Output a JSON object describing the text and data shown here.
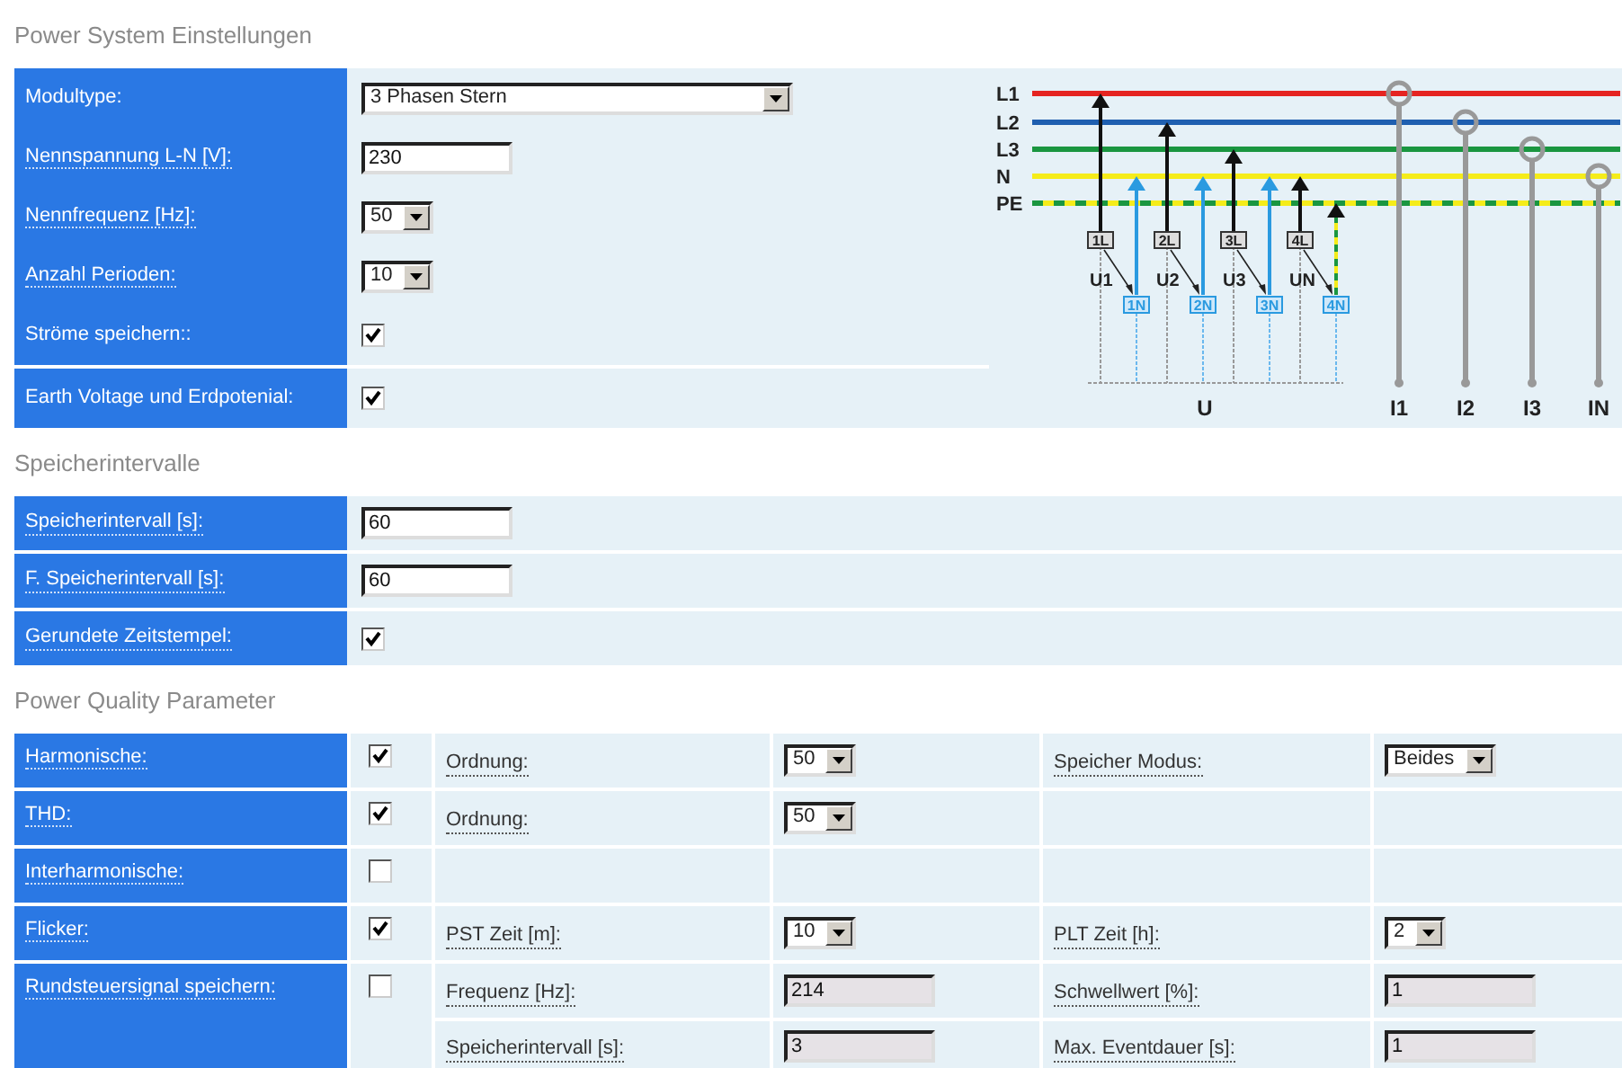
{
  "sections": [
    {
      "title": "Power System Einstellungen",
      "groups": [
        [
          {
            "label": "Modultype:",
            "underlined": false,
            "control": {
              "kind": "select-wide",
              "value": "3 Phasen Stern"
            }
          },
          {
            "label": "Nennspannung L-N [V]:",
            "underlined": true,
            "control": {
              "kind": "input",
              "value": "230",
              "disabled": false
            }
          },
          {
            "label": "Nennfrequenz [Hz]:",
            "underlined": true,
            "control": {
              "kind": "select",
              "value": "50"
            }
          },
          {
            "label": "Anzahl Perioden:",
            "underlined": true,
            "control": {
              "kind": "select",
              "value": "10"
            }
          },
          {
            "label": "Ströme speichern::",
            "underlined": false,
            "control": {
              "kind": "checkbox",
              "checked": true
            }
          }
        ],
        [
          {
            "label": "Earth Voltage und Erdpotenial:",
            "underlined": false,
            "control": {
              "kind": "checkbox",
              "checked": true
            }
          }
        ]
      ],
      "diagram": {
        "lines": [
          {
            "label": "L1",
            "color": "#e52421",
            "kind": "solid"
          },
          {
            "label": "L2",
            "color": "#1f5fb0",
            "kind": "solid"
          },
          {
            "label": "L3",
            "color": "#1a9640",
            "kind": "solid"
          },
          {
            "label": "N",
            "color": "#f5ec1a",
            "kind": "solid"
          },
          {
            "label": "PE",
            "color": "#1a9640",
            "kind": "striped"
          }
        ],
        "channels": [
          {
            "l_terminal": "1L",
            "voltage": "U1",
            "n_terminal": "1N"
          },
          {
            "l_terminal": "2L",
            "voltage": "U2",
            "n_terminal": "2N"
          },
          {
            "l_terminal": "3L",
            "voltage": "U3",
            "n_terminal": "3N"
          },
          {
            "l_terminal": "4L",
            "voltage": "UN",
            "n_terminal": "4N"
          }
        ],
        "voltage_label": "U",
        "currents": [
          "I1",
          "I2",
          "I3",
          "IN"
        ]
      }
    },
    {
      "title": "Speicherintervalle",
      "groups": [
        [
          {
            "label": "Speicherintervall [s]:",
            "underlined": true,
            "control": {
              "kind": "input",
              "value": "60",
              "disabled": false
            }
          }
        ],
        [
          {
            "label": "F. Speicherintervall [s]:",
            "underlined": true,
            "control": {
              "kind": "input",
              "value": "60",
              "disabled": false
            }
          }
        ],
        [
          {
            "label": "Gerundete Zeitstempel:",
            "underlined": true,
            "control": {
              "kind": "checkbox",
              "checked": true
            }
          }
        ]
      ]
    },
    {
      "title": "Power Quality Parameter",
      "rows": [
        {
          "label": "Harmonische:",
          "checked": true,
          "lines": [
            [
              {
                "label": "Ordnung:",
                "control": {
                  "kind": "select",
                  "value": "50"
                }
              },
              {
                "label": "Speicher Modus:",
                "control": {
                  "kind": "select",
                  "value": "Beides"
                }
              }
            ]
          ]
        },
        {
          "label": "THD:",
          "checked": true,
          "lines": [
            [
              {
                "label": "Ordnung:",
                "control": {
                  "kind": "select",
                  "value": "50"
                }
              }
            ]
          ]
        },
        {
          "label": "Interharmonische:",
          "checked": false
        },
        {
          "label": "Flicker:",
          "checked": true,
          "lines": [
            [
              {
                "label": "PST Zeit [m]:",
                "control": {
                  "kind": "select",
                  "value": "10"
                }
              },
              {
                "label": "PLT Zeit [h]:",
                "control": {
                  "kind": "select",
                  "value": "2"
                }
              }
            ]
          ]
        },
        {
          "label": "Rundsteuersignal speichern:",
          "checked": false,
          "lines": [
            [
              {
                "label": "Frequenz [Hz]:",
                "control": {
                  "kind": "input",
                  "value": "214",
                  "disabled": true
                }
              },
              {
                "label": "Schwellwert [%]:",
                "control": {
                  "kind": "input",
                  "value": "1",
                  "disabled": true
                }
              }
            ],
            [
              {
                "label": "Speicherintervall [s]:",
                "control": {
                  "kind": "input",
                  "value": "3",
                  "disabled": true
                }
              },
              {
                "label": "Max. Eventdauer [s]:",
                "control": {
                  "kind": "input",
                  "value": "1",
                  "disabled": true
                }
              }
            ]
          ]
        }
      ]
    }
  ]
}
